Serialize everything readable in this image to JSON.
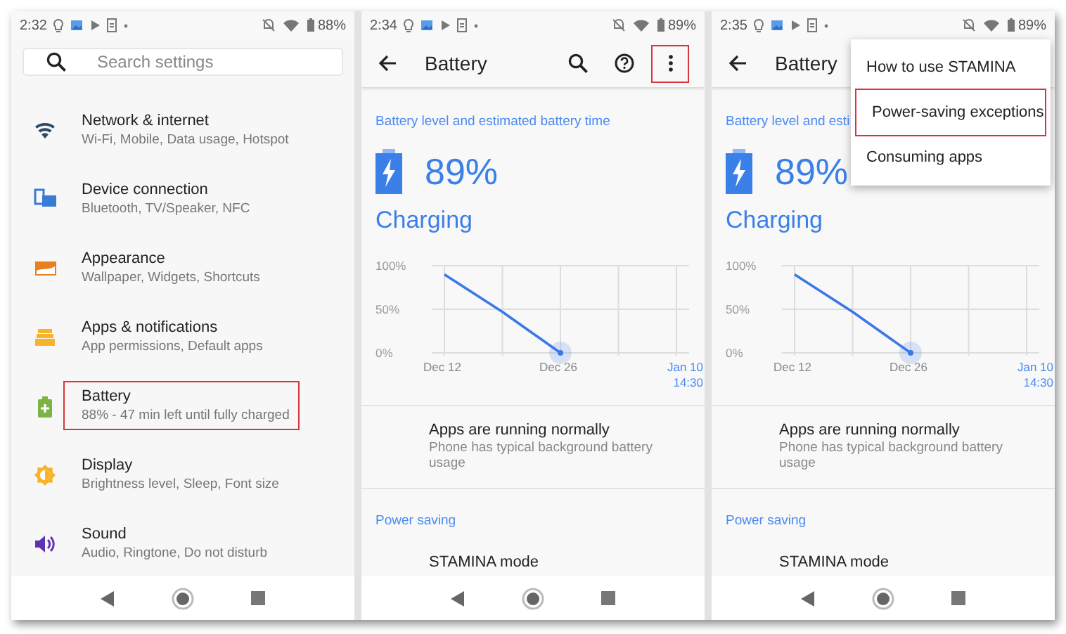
{
  "screens": [
    {
      "kind": "settings",
      "status_bar": {
        "time": "2:32",
        "battery": "88%"
      },
      "search": {
        "placeholder": "Search settings"
      },
      "items": [
        {
          "kind": "network",
          "title": "Network & internet",
          "subtitle": "Wi-Fi, Mobile, Data usage, Hotspot",
          "highlighted": false
        },
        {
          "kind": "device",
          "title": "Device connection",
          "subtitle": "Bluetooth, TV/Speaker, NFC",
          "highlighted": false
        },
        {
          "kind": "appearance",
          "title": "Appearance",
          "subtitle": "Wallpaper, Widgets, Shortcuts",
          "highlighted": false
        },
        {
          "kind": "apps",
          "title": "Apps & notifications",
          "subtitle": "App permissions, Default apps",
          "highlighted": false
        },
        {
          "kind": "battery",
          "title": "Battery",
          "subtitle": "88% - 47 min left until fully charged",
          "highlighted": true
        },
        {
          "kind": "display",
          "title": "Display",
          "subtitle": "Brightness level, Sleep, Font size",
          "highlighted": false
        },
        {
          "kind": "sound",
          "title": "Sound",
          "subtitle": "Audio, Ringtone, Do not disturb",
          "highlighted": false
        }
      ]
    },
    {
      "kind": "battery",
      "status_bar": {
        "time": "2:34",
        "battery": "89%"
      },
      "title": "Battery",
      "actions": [
        {
          "kind": "search",
          "highlighted": false
        },
        {
          "kind": "help",
          "highlighted": false
        },
        {
          "kind": "more",
          "highlighted": true
        }
      ],
      "section": "Battery level and estimated battery time",
      "level_text": "89%",
      "status": "Charging",
      "chart_data": {
        "type": "line",
        "grid": true,
        "categories": [
          "Dec 12",
          null,
          "Dec 26",
          null,
          "Jan 10 14:30"
        ],
        "series": [
          {
            "color": "#3b78e7",
            "values": [
              90,
              47,
              0,
              null,
              null
            ]
          }
        ],
        "ylim": [
          0,
          100
        ],
        "yticks": [
          {
            "value": 0,
            "label": "0%"
          },
          {
            "value": 50,
            "label": "50%"
          },
          {
            "value": 100,
            "label": "100%"
          }
        ]
      },
      "tip": {
        "title": "Apps are running normally",
        "subtitle": "Phone has typical background battery usage"
      },
      "power_section": "Power saving",
      "power_item": "STAMINA mode"
    },
    {
      "kind": "battery",
      "status_bar": {
        "time": "2:35",
        "battery": "89%"
      },
      "title": "Battery",
      "section": "Battery level and esti",
      "level_text": "89%",
      "status": "Charging",
      "chart_data": {
        "type": "line",
        "grid": true,
        "categories": [
          "Dec 12",
          null,
          "Dec 26",
          null,
          "Jan 10 14:30"
        ],
        "series": [
          {
            "color": "#3b78e7",
            "values": [
              90,
              47,
              0,
              null,
              null
            ]
          }
        ],
        "ylim": [
          0,
          100
        ],
        "yticks": [
          {
            "value": 0,
            "label": "0%"
          },
          {
            "value": 50,
            "label": "50%"
          },
          {
            "value": 100,
            "label": "100%"
          }
        ]
      },
      "tip": {
        "title": "Apps are running normally",
        "subtitle": "Phone has typical background battery usage"
      },
      "power_section": "Power saving",
      "power_item": "STAMINA mode",
      "menu": [
        {
          "label": "How to use STAMINA",
          "highlighted": false
        },
        {
          "label": "Power-saving exceptions",
          "highlighted": true
        },
        {
          "label": "Consuming apps",
          "highlighted": false
        }
      ]
    }
  ]
}
